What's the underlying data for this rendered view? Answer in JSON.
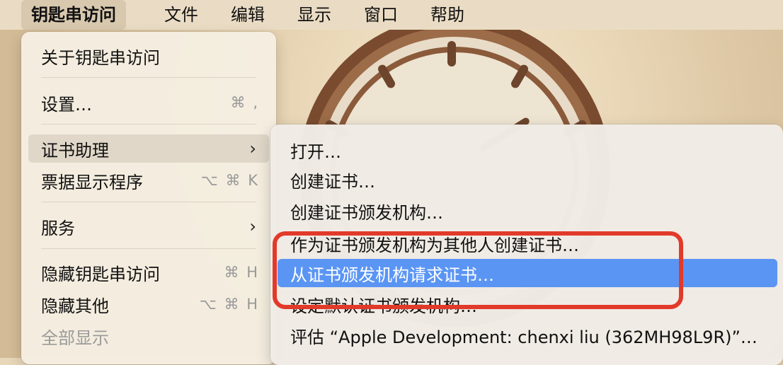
{
  "menubar": {
    "apple_symbol": "",
    "app_name": "钥匙串访问",
    "items": [
      "文件",
      "编辑",
      "显示",
      "窗口",
      "帮助"
    ]
  },
  "app_menu": {
    "about": "关于钥匙串访问",
    "settings": {
      "label": "设置…",
      "shortcut": "⌘ ,"
    },
    "cert_assistant": {
      "label": "证书助理",
      "chevron": "›"
    },
    "ticket_viewer": {
      "label": "票据显示程序",
      "shortcut": "⌥ ⌘ K"
    },
    "services": {
      "label": "服务",
      "chevron": "›"
    },
    "hide_app": {
      "label": "隐藏钥匙串访问",
      "shortcut": "⌘ H"
    },
    "hide_others": {
      "label": "隐藏其他",
      "shortcut": "⌥ ⌘ H"
    },
    "show_all": {
      "label": "全部显示"
    }
  },
  "submenu": {
    "items": [
      "打开…",
      "创建证书…",
      "创建证书颁发机构…",
      "作为证书颁发机构为其他人创建证书…",
      "从证书颁发机构请求证书…",
      "设定默认证书颁发机构…",
      "评估 “Apple Development: chenxi liu (362MH98L9R)”…"
    ],
    "selected_index": 4
  },
  "colors": {
    "selection": "#5b95f4",
    "annotation_box": "#e23a2a"
  },
  "icons": {
    "apple": "apple-icon",
    "chevron": "chevron-right-icon"
  }
}
